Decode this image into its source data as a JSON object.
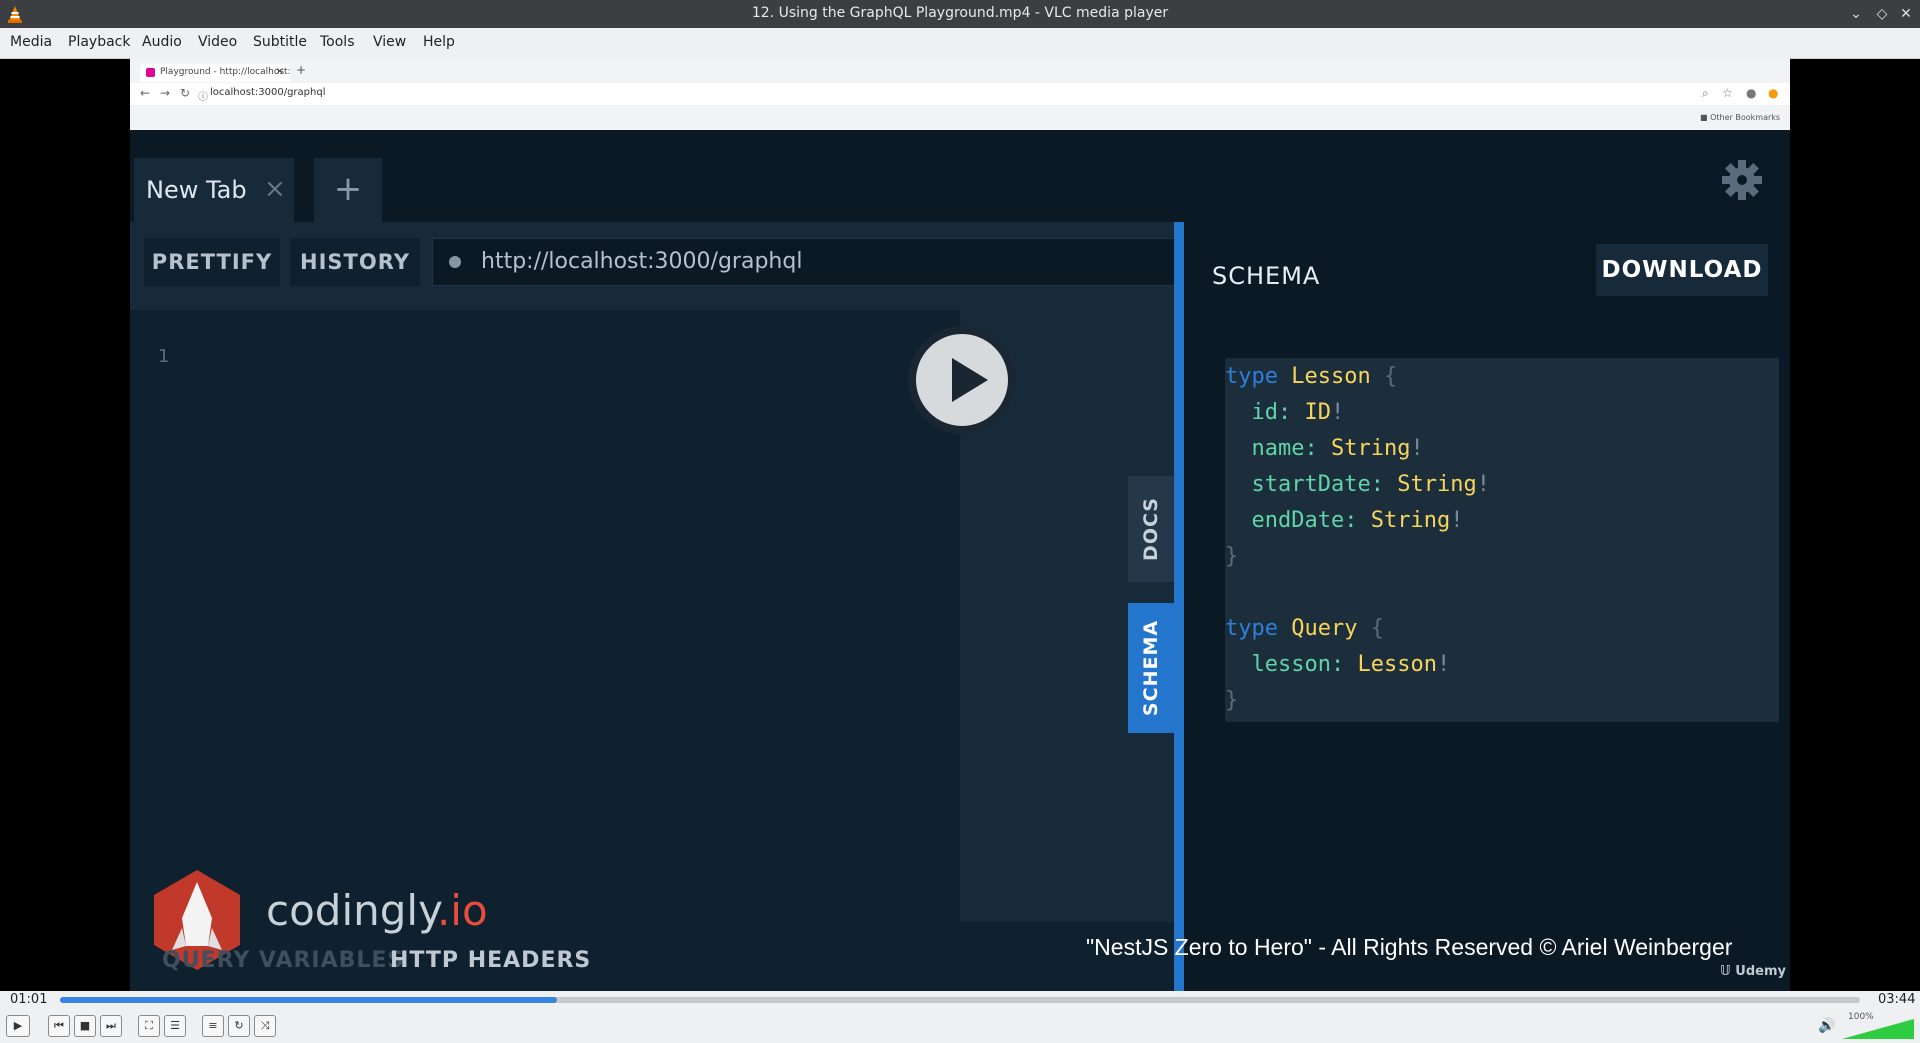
{
  "window": {
    "title": "12. Using the GraphQL Playground.mp4 - VLC media player"
  },
  "menu": [
    "Media",
    "Playback",
    "Audio",
    "Video",
    "Subtitle",
    "Tools",
    "View",
    "Help"
  ],
  "browser": {
    "tab_title": "Playground - http://localhost:",
    "tab_close": "×",
    "new_tab": "+",
    "address": "localhost:3000/graphql",
    "bookmarks": "Other Bookmarks"
  },
  "playground": {
    "tab_label": "New Tab",
    "tab_close": "×",
    "add_tab": "+",
    "prettify": "PRETTIFY",
    "history": "HISTORY",
    "endpoint": "http://localhost:3000/graphql",
    "line_number": "1",
    "docs_tab": "DOCS",
    "schema_tab": "SCHEMA",
    "schema_title": "SCHEMA",
    "download": "DOWNLOAD",
    "query_variables": "QUERY VARIABLES",
    "http_headers": "HTTP HEADERS"
  },
  "schema_code": {
    "lesson": {
      "kw": "type",
      "name": "Lesson",
      "open": "{",
      "close": "}",
      "fields": [
        {
          "name": "id",
          "type": "ID"
        },
        {
          "name": "name",
          "type": "String"
        },
        {
          "name": "startDate",
          "type": "String"
        },
        {
          "name": "endDate",
          "type": "String"
        }
      ]
    },
    "query": {
      "kw": "type",
      "name": "Query",
      "open": "{",
      "close": "}",
      "fields": [
        {
          "name": "lesson",
          "type": "Lesson"
        }
      ]
    }
  },
  "branding": {
    "logo_text": "codingly",
    "logo_tld": ".io",
    "copyright": "\"NestJS Zero to Hero\" - All Rights Reserved © Ariel Weinberger",
    "udemy": "Udemy"
  },
  "player": {
    "elapsed": "01:01",
    "total": "03:44",
    "progress_fraction": 0.276,
    "volume_label": "100%",
    "accent_color": "#3584e4"
  }
}
